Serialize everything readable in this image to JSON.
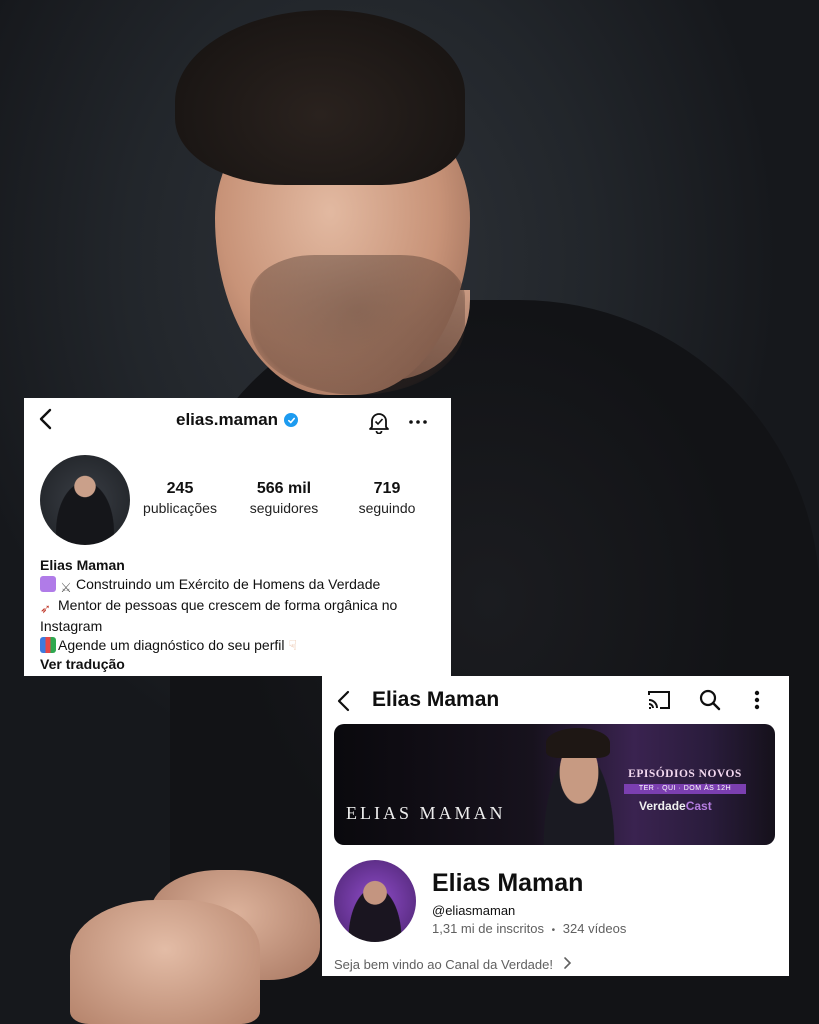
{
  "instagram": {
    "username": "elias.maman",
    "stats": [
      {
        "value": "245",
        "label": "publicações"
      },
      {
        "value": "566 mil",
        "label": "seguidores"
      },
      {
        "value": "719",
        "label": "seguindo"
      }
    ],
    "bio": {
      "name": "Elias Maman",
      "line1": "Construindo um Exército de Homens da Verdade",
      "line2": "Mentor de pessoas que crescem de forma orgânica no",
      "line3": "Instagram",
      "line4": "Agende um diagnóstico do seu perfil",
      "see_translation": "Ver tradução"
    },
    "icons": [
      "back-arrow-icon",
      "verified-badge-icon",
      "bell-icon",
      "more-icon"
    ]
  },
  "youtube": {
    "header_title": "Elias Maman",
    "banner": {
      "name": "ELIAS MAMAN",
      "episodes": "EPISÓDIOS NOVOS",
      "schedule": "TER · QUI · DOM ÀS 12H",
      "show_name_a": "Verdade",
      "show_name_b": "Cast"
    },
    "channel_name": "Elias Maman",
    "handle": "@eliasmaman",
    "subscribers": "1,31 mi de inscritos",
    "separator": "•",
    "videos": "324 vídeos",
    "description": "Seja bem vindo ao Canal da Verdade!",
    "icons": [
      "back-arrow-icon",
      "cast-icon",
      "search-icon",
      "more-vertical-icon",
      "chevron-right-icon"
    ]
  },
  "colors": {
    "verified": "#1d9bf0",
    "banner_accent": "#7b3fb0"
  }
}
